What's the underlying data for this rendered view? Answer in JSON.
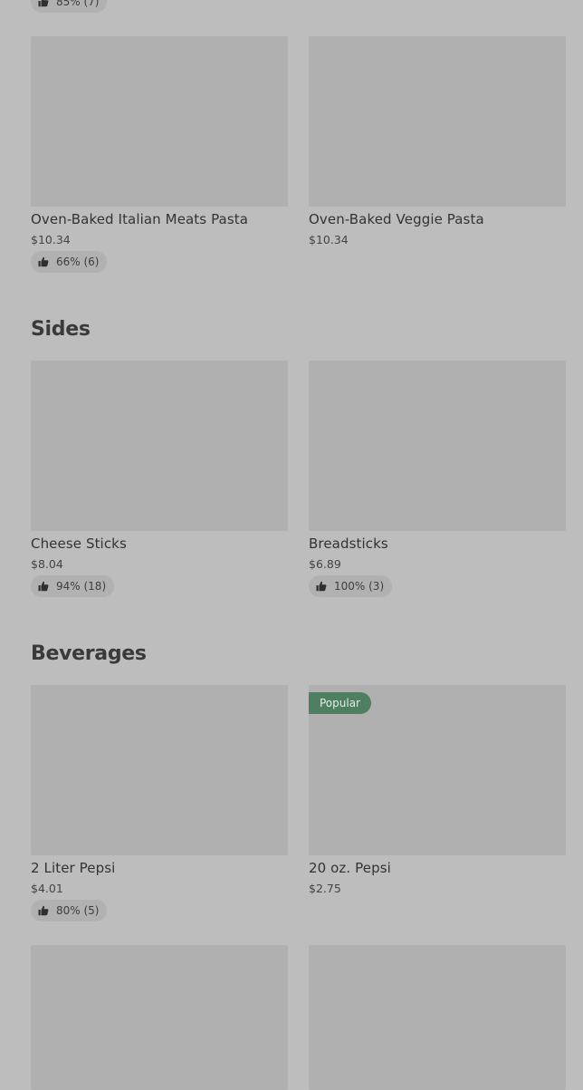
{
  "top_partial": {
    "rating": "85% (7)"
  },
  "pasta_items": [
    {
      "name": "Oven-Baked Italian Meats Pasta",
      "price": "$10.34",
      "rating": "66% (6)"
    },
    {
      "name": "Oven-Baked Veggie Pasta",
      "price": "$10.34"
    }
  ],
  "sides": {
    "title": "Sides",
    "items": [
      {
        "name": "Cheese Sticks",
        "price": "$8.04",
        "rating": "94% (18)"
      },
      {
        "name": "Breadsticks",
        "price": "$6.89",
        "rating": "100% (3)"
      }
    ]
  },
  "beverages": {
    "title": "Beverages",
    "items": [
      {
        "name": "2 Liter Pepsi",
        "price": "$4.01",
        "rating": "80% (5)"
      },
      {
        "name": "20 oz. Pepsi",
        "price": "$2.75",
        "badge": "Popular"
      }
    ]
  },
  "colors": {
    "background": "#bdbdbd",
    "image_placeholder": "#b0b0b0",
    "badge_green": "#4e7f61"
  },
  "icons": {
    "rating": "thumbs-up-icon"
  }
}
